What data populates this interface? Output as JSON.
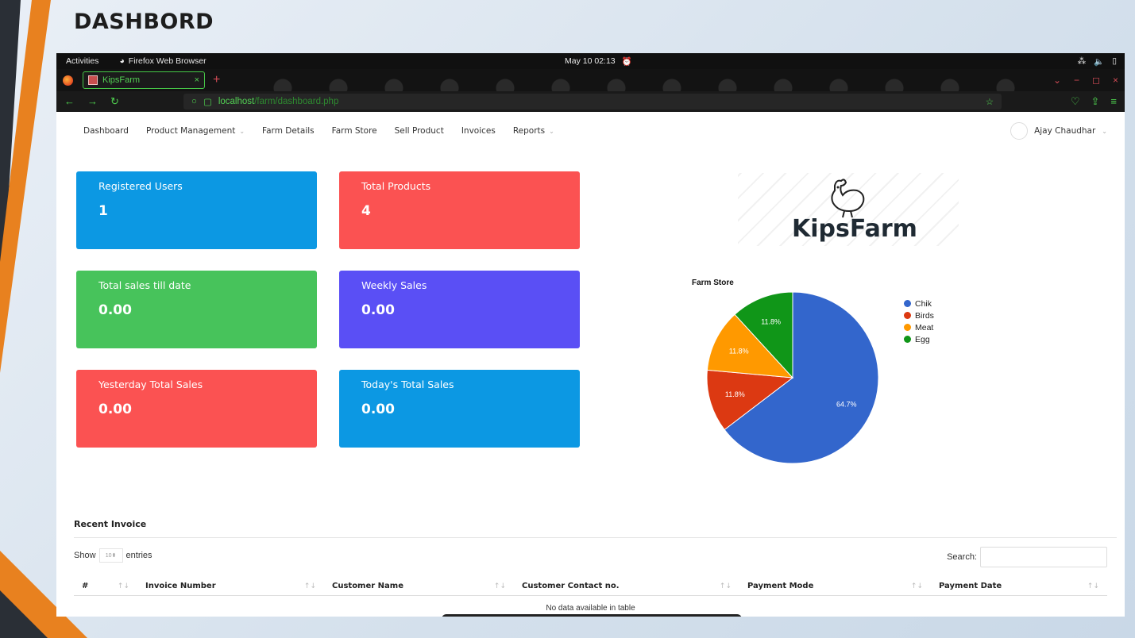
{
  "slide_title": "DASHBORD",
  "system_bar": {
    "activities": "Activities",
    "app_name": "Firefox Web Browser",
    "clock": "May 10  02:13"
  },
  "browser": {
    "tab_title": "KipsFarm",
    "url_host": "localhost",
    "url_path": "/farm/dashboard.php"
  },
  "nav": {
    "items": [
      {
        "label": "Dashboard",
        "dropdown": false
      },
      {
        "label": "Product Management",
        "dropdown": true
      },
      {
        "label": "Farm Details",
        "dropdown": false
      },
      {
        "label": "Farm Store",
        "dropdown": false
      },
      {
        "label": "Sell Product",
        "dropdown": false
      },
      {
        "label": "Invoices",
        "dropdown": false
      },
      {
        "label": "Reports",
        "dropdown": true
      }
    ],
    "user_name": "Ajay Chaudhar"
  },
  "cards": [
    {
      "label": "Registered Users",
      "value": "1",
      "color": "#0c98e3"
    },
    {
      "label": "Total Products",
      "value": "4",
      "color": "#fb5252"
    },
    {
      "label": "Total sales till date",
      "value": "0.00",
      "color": "#47c35b"
    },
    {
      "label": "Weekly Sales",
      "value": "0.00",
      "color": "#5a4ff5"
    },
    {
      "label": "Yesterday Total Sales",
      "value": "0.00",
      "color": "#fb5252"
    },
    {
      "label": "Today's Total Sales",
      "value": "0.00",
      "color": "#0c98e3"
    }
  ],
  "logo_text": "KipsFarm",
  "chart_data": {
    "type": "pie",
    "title": "Farm Store",
    "slices": [
      {
        "label": "Chik",
        "value": 64.7,
        "color": "#3366cc"
      },
      {
        "label": "Birds",
        "value": 11.8,
        "color": "#dc3912"
      },
      {
        "label": "Meat",
        "value": 11.8,
        "color": "#ff9900"
      },
      {
        "label": "Egg",
        "value": 11.8,
        "color": "#109618"
      }
    ],
    "slice_labels": [
      "64.7%",
      "11.8%",
      "11.8%",
      "11.8%"
    ],
    "legend_position": "right"
  },
  "recent_invoice": {
    "title": "Recent Invoice",
    "show_label": "Show",
    "entries_value": "10",
    "entries_label": "entries",
    "search_label": "Search:",
    "columns": [
      "#",
      "Invoice Number",
      "Customer Name",
      "Customer Contact no.",
      "Payment Mode",
      "Payment Date"
    ],
    "empty_message": "No data available in table"
  }
}
